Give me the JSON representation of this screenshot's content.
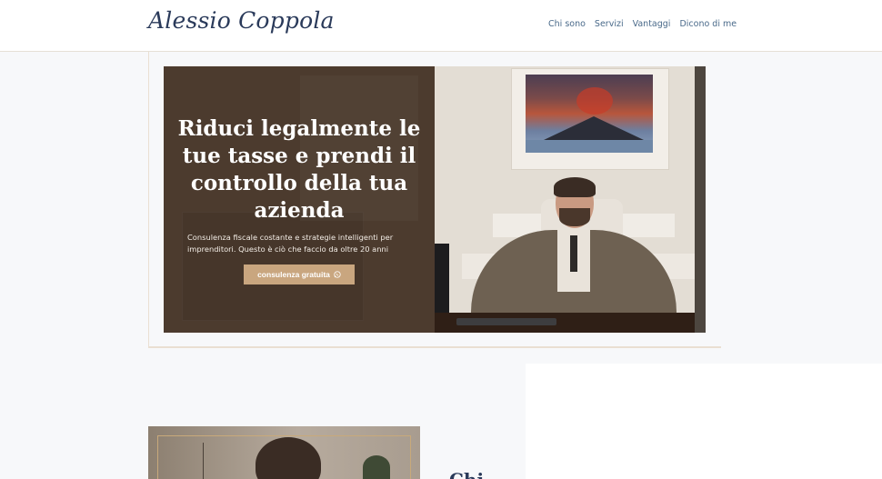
{
  "header": {
    "logo": "Alessio Coppola",
    "nav": [
      "Chi sono",
      "Servizi",
      "Vantaggi",
      "Dicono di me"
    ]
  },
  "hero": {
    "title": "Riduci legalmente le tue tasse e prendi il controllo della tua azienda",
    "subtitle": "Consulenza fiscale costante e strategie intelligenti per imprenditori. Questo è ciò che faccio da oltre 20 anni",
    "cta_label": "consulenza gratuita",
    "cta_icon": "whatsapp-icon"
  },
  "about": {
    "heading": "Chi"
  },
  "colors": {
    "accent": "#c9a67f",
    "navy": "#2a3a5a",
    "hero_bg": "#4c3b2e"
  }
}
